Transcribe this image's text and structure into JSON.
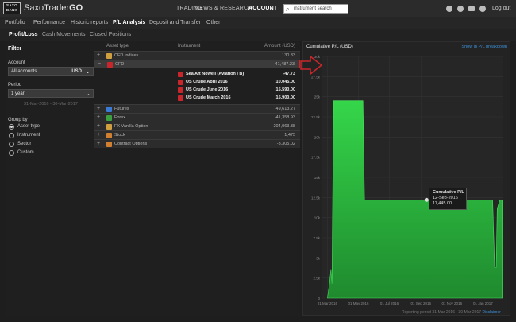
{
  "app": {
    "logo_top": "SAXO",
    "logo_bottom": "BANK",
    "brand": "SaxoTrader",
    "brand_suffix": "GO"
  },
  "top_nav": [
    {
      "label": "TRADING",
      "active": false
    },
    {
      "label": "NEWS & RESEARCH",
      "active": false
    },
    {
      "label": "ACCOUNT",
      "active": true
    }
  ],
  "search": {
    "value": "instrument search"
  },
  "header_icons": [
    "help-icon",
    "info-icon",
    "mail-icon",
    "settings-icon"
  ],
  "logout_label": "Log out",
  "sub_nav": [
    {
      "label": "Portfolio",
      "active": false
    },
    {
      "label": "Performance",
      "active": false
    },
    {
      "label": "Historic reports",
      "active": false
    },
    {
      "label": "P/L Analysis",
      "active": true
    },
    {
      "label": "Deposit and Transfer",
      "active": false
    },
    {
      "label": "Other",
      "active": false
    }
  ],
  "tabs": [
    {
      "label": "Profit/Loss",
      "active": true
    },
    {
      "label": "Cash Movements",
      "active": false
    },
    {
      "label": "Closed Positions",
      "active": false
    }
  ],
  "filter": {
    "title": "Filter",
    "account_label": "Account",
    "account_value": "All accounts",
    "account_currency": "USD",
    "period_label": "Period",
    "period_value": "1 year",
    "period_range": "31-Mar-2016 - 30-Mar-2017",
    "group_label": "Group by",
    "group_options": [
      {
        "label": "Asset type",
        "selected": true
      },
      {
        "label": "Instrument",
        "selected": false
      },
      {
        "label": "Sector",
        "selected": false
      },
      {
        "label": "Custom",
        "selected": false
      }
    ]
  },
  "table": {
    "headers": [
      "Asset type",
      "Instrument",
      "Amount (USD)"
    ],
    "rows": [
      {
        "kind": "group",
        "expander": "+",
        "icon_color": "#d0a040",
        "name": "CFD Indices",
        "amount": "130.33",
        "selected": false
      },
      {
        "kind": "group",
        "expander": "−",
        "icon_color": "#c8262b",
        "name": "CFD",
        "amount": "41,487.23",
        "selected": true
      },
      {
        "kind": "sub",
        "name": "Sea Aft Nowell (Aviation I B)",
        "amount": "-47.73"
      },
      {
        "kind": "sub",
        "name": "US Crude April 2016",
        "amount": "10,045.00"
      },
      {
        "kind": "sub",
        "name": "US Crude June 2016",
        "amount": "15,590.00"
      },
      {
        "kind": "sub",
        "name": "US Crude March 2016",
        "amount": "15,900.00"
      },
      {
        "kind": "group",
        "expander": "+",
        "icon_color": "#3a7bd5",
        "name": "Futures",
        "amount": "49,613.27",
        "selected": false
      },
      {
        "kind": "group",
        "expander": "+",
        "icon_color": "#3aa040",
        "name": "Forex",
        "amount": "-41,358.93",
        "selected": false
      },
      {
        "kind": "group",
        "expander": "+",
        "icon_color": "#d0a040",
        "name": "FX Vanilla Option",
        "amount": "204,063.38",
        "selected": false
      },
      {
        "kind": "group",
        "expander": "+",
        "icon_color": "#d08030",
        "name": "Stock",
        "amount": "1,475",
        "selected": false
      },
      {
        "kind": "group",
        "expander": "+",
        "icon_color": "#d08030",
        "name": "Contract Options",
        "amount": "-3,305.02",
        "selected": false
      }
    ]
  },
  "chart_title": "Cumulative P/L (USD)",
  "chart_link": "Show in P/L breakdown",
  "tooltip": {
    "title": "Cumulative P/L",
    "date": "12-Sep-2016",
    "value": "11,445.00"
  },
  "footnote_text": "Reporting period 31-Mar-2016 - 30-Mar-2017",
  "footnote_link": "Disclaimer",
  "colors": {
    "accent": "#c8262b",
    "chart_fill": "#2ecc40",
    "link": "#3d8fd6"
  },
  "chart_data": {
    "type": "area",
    "title": "Cumulative P/L (USD)",
    "xlabel": "",
    "ylabel": "",
    "x_ticks": [
      "01 Mar 2016",
      "01 May 2016",
      "01 Jul 2016",
      "01 Sep 2016",
      "01 Nov 2016",
      "01 Jan 2017"
    ],
    "y_ticks": [
      "0",
      "2.5k",
      "5k",
      "7.5k",
      "10k",
      "12.5k",
      "15k",
      "17.5k",
      "20k",
      "22.5k",
      "25k",
      "27.5k",
      "30k"
    ],
    "ylim": [
      0,
      30000
    ],
    "grid": true,
    "x": [
      "2016-03-01",
      "2016-03-05",
      "2016-03-08",
      "2016-03-10",
      "2016-03-13",
      "2016-05-10",
      "2016-05-13",
      "2016-05-15",
      "2017-01-20",
      "2017-01-24",
      "2017-01-27",
      "2017-01-29",
      "2017-02-03",
      "2017-02-08"
    ],
    "values": [
      0,
      1800,
      3600,
      1800,
      24500,
      24500,
      12200,
      12200,
      12200,
      3800,
      3800,
      11100,
      12200,
      12200
    ]
  }
}
